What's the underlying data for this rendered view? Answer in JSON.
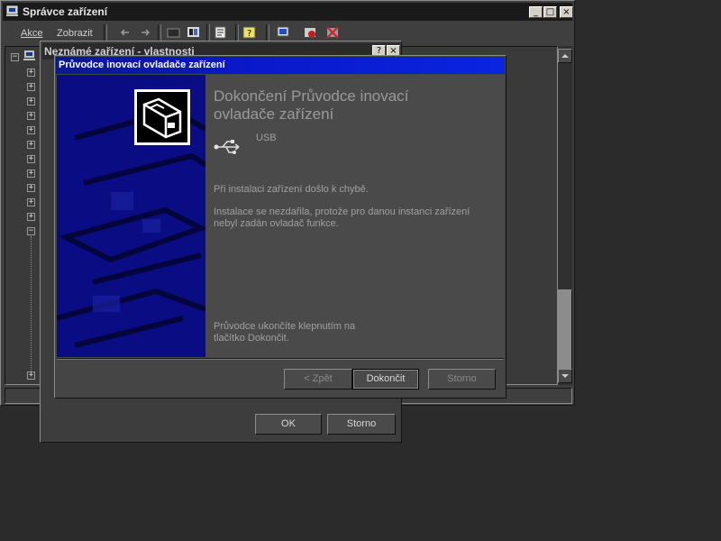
{
  "devmgr": {
    "title": "Správce zařízení",
    "menu": [
      {
        "label": "Akce"
      },
      {
        "label": "Zobrazit"
      }
    ],
    "tree": {
      "collapse_symbol": "−",
      "expand_symbol": "+"
    }
  },
  "props": {
    "title": "Neznámé zařízení - vlastnosti",
    "help_btn": "?",
    "close_btn": "×",
    "ok_label": "OK",
    "cancel_label": "Storno"
  },
  "wizard": {
    "title": "Průvodce inovací ovladače zařízení",
    "heading": "Dokončení Průvodce inovací ovladače zařízení",
    "device_name": "USB",
    "error_line": "Při instalaci zařízení došlo k chybě.",
    "detail_line": "Instalace se nezdařila, protože pro danou instanci zařízení nebyl zadán ovladač funkce.",
    "finish_hint": "Průvodce ukončíte klepnutím na tlačítko Dokončit.",
    "back_label": "< Zpět",
    "finish_label": "Dokončit",
    "cancel_label": "Storno"
  },
  "window_controls": {
    "minimize": "_",
    "maximize": "□",
    "close": "×"
  },
  "colors": {
    "wizard_title": "#0a18c8",
    "wizard_banner": "#0b0d8a",
    "desktop": "#2b2b2b",
    "panel": "#4a4a4a"
  }
}
